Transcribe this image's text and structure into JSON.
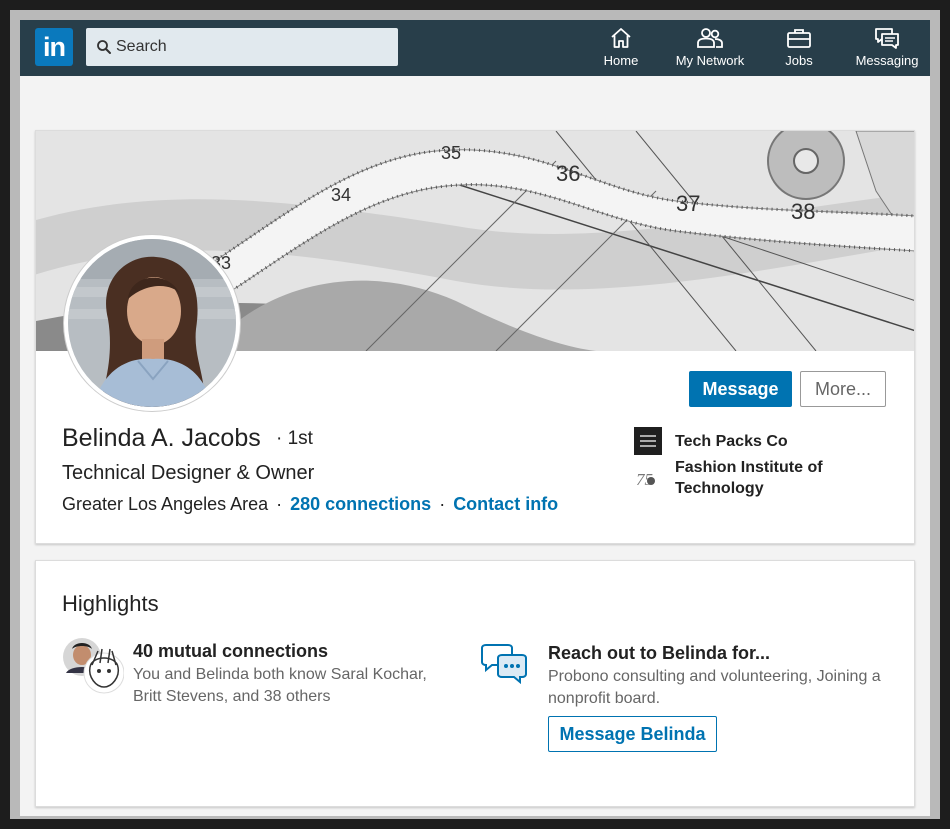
{
  "header": {
    "logo_text": "in",
    "search": {
      "placeholder": "Search"
    },
    "nav": [
      {
        "label": "Home",
        "icon": "home-icon"
      },
      {
        "label": "My Network",
        "icon": "network-icon"
      },
      {
        "label": "Jobs",
        "icon": "briefcase-icon"
      },
      {
        "label": "Messaging",
        "icon": "messaging-icon"
      }
    ]
  },
  "profile": {
    "name": "Belinda A. Jacobs",
    "degree_separator": "·",
    "degree": "1st",
    "headline": "Technical Designer & Owner",
    "location": "Greater Los Angeles Area",
    "connections": "280 connections",
    "contact_info": "Contact info",
    "actions": {
      "message": "Message",
      "more": "More..."
    },
    "banner_tape_numbers": [
      "33",
      "34",
      "35",
      "36",
      "37",
      "38"
    ],
    "organizations": [
      {
        "name": "Tech Packs Co",
        "logo": "tech-packs-logo"
      },
      {
        "name": "Fashion Institute of Technology",
        "logo": "fit-logo"
      }
    ]
  },
  "highlights": {
    "title": "Highlights",
    "mutual": {
      "title": "40 mutual connections",
      "text": "You and Belinda both know Saral Kochar, Britt Stevens, and 38 others"
    },
    "reach_out": {
      "title": "Reach out to Belinda for...",
      "text": "Probono consulting and volunteering, Joining a nonprofit board.",
      "button": "Message Belinda"
    }
  },
  "colors": {
    "nav_bg": "#283e4a",
    "brand_blue": "#0073b1",
    "page_bg": "#f3f3f3"
  }
}
